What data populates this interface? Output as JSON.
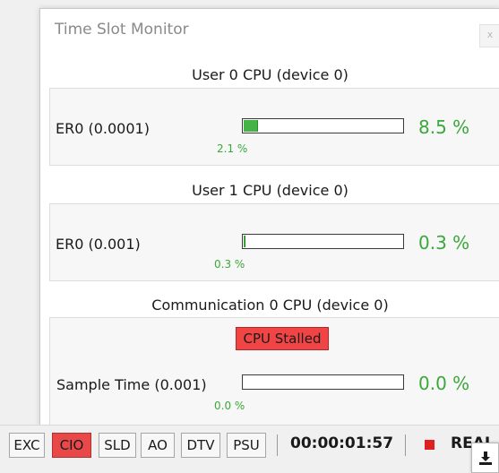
{
  "window": {
    "title": "Time Slot Monitor",
    "close_label": "x"
  },
  "sections": [
    {
      "title": "User 0 CPU (device 0)",
      "rows": [
        {
          "label": "ER0 (0.0001)",
          "value_pct": 8.5,
          "value_text": "8.5 %",
          "sub_text": "2.1 %",
          "sub_pct": 2.1
        }
      ]
    },
    {
      "title": "User 1 CPU (device 0)",
      "rows": [
        {
          "label": "ER0 (0.001)",
          "value_pct": 0.3,
          "value_text": "0.3 %",
          "sub_text": "0.3 %",
          "sub_pct": 0.3
        }
      ]
    },
    {
      "title": "Communication 0 CPU (device 0)",
      "status_badge": "CPU Stalled",
      "rows": [
        {
          "label": "Sample Time (0.001)",
          "value_pct": 0.0,
          "value_text": "0.0 %",
          "sub_text": "0.0 %",
          "sub_pct": 0.0
        }
      ]
    }
  ],
  "statusbar": {
    "buttons": [
      {
        "label": "EXC",
        "active": false
      },
      {
        "label": "CIO",
        "active": true
      },
      {
        "label": "SLD",
        "active": false
      },
      {
        "label": "AO",
        "active": false
      },
      {
        "label": "DTV",
        "active": false
      },
      {
        "label": "PSU",
        "active": false
      }
    ],
    "timer": "00:00:01:57",
    "mode_text": "REAL",
    "record_icon": "red-square-icon",
    "download_icon": "download-icon"
  },
  "colors": {
    "progress_fill": "#45b345",
    "percent_text": "#3aa83a",
    "stalled_bg": "#f14545",
    "active_button_bg": "#e84848",
    "record_red": "#e02020"
  }
}
